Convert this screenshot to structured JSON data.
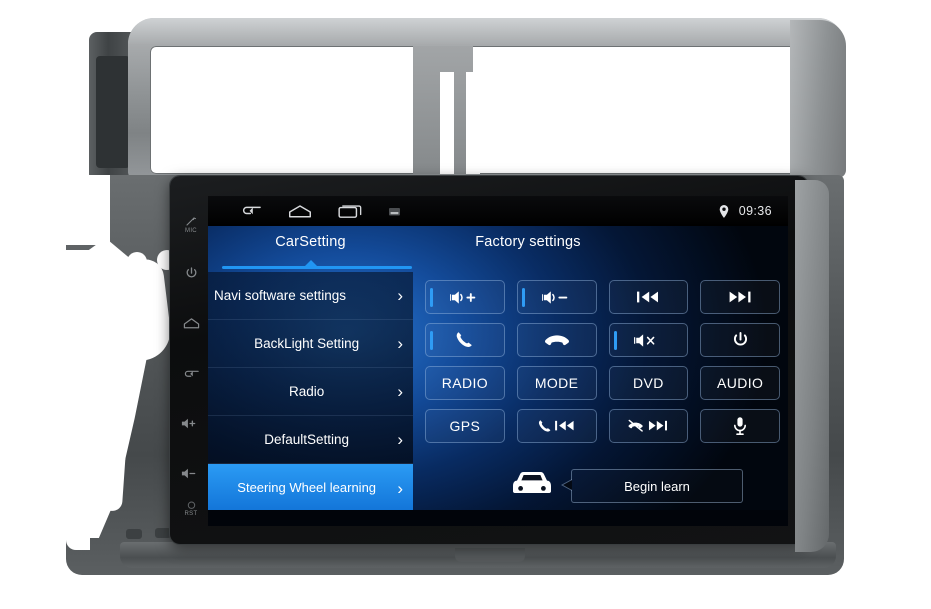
{
  "device": {
    "name": "car-head-unit-with-dash-fascia",
    "hard_keys": [
      {
        "name": "mic-key",
        "label": "MIC"
      },
      {
        "name": "power-key",
        "label": ""
      },
      {
        "name": "home-key",
        "label": ""
      },
      {
        "name": "back-key",
        "label": ""
      },
      {
        "name": "volume-up-key",
        "label": ""
      },
      {
        "name": "volume-down-key",
        "label": ""
      },
      {
        "name": "reset-key",
        "label": "RST"
      }
    ]
  },
  "statusbar": {
    "icons": [
      "back-icon",
      "home-icon",
      "recents-icon",
      "screenshot-icon"
    ],
    "location_icon": "location-pin-icon",
    "clock": "09:36"
  },
  "tabs": [
    {
      "label": "CarSetting",
      "active": true
    },
    {
      "label": "Factory settings",
      "active": false
    }
  ],
  "sidebar": {
    "items": [
      {
        "label": "Navi software settings",
        "chevron": "›",
        "active": false
      },
      {
        "label": "BackLight Setting",
        "chevron": "›",
        "active": false
      },
      {
        "label": "Radio",
        "chevron": "›",
        "active": false
      },
      {
        "label": "DefaultSetting",
        "chevron": "›",
        "active": false
      },
      {
        "label": "Steering Wheel learning",
        "chevron": "›",
        "active": true
      }
    ]
  },
  "steering_wheel_panel": {
    "buttons": [
      {
        "id": "vol-up",
        "text": "",
        "icon": "volume-up-icon",
        "indicator": true
      },
      {
        "id": "vol-down",
        "text": "",
        "icon": "volume-down-icon",
        "indicator": true
      },
      {
        "id": "prev-track",
        "text": "",
        "icon": "previous-track-icon",
        "indicator": false
      },
      {
        "id": "next-track",
        "text": "",
        "icon": "next-track-icon",
        "indicator": false
      },
      {
        "id": "call",
        "text": "",
        "icon": "phone-answer-icon",
        "indicator": true
      },
      {
        "id": "hangup",
        "text": "",
        "icon": "phone-hangup-icon",
        "indicator": false
      },
      {
        "id": "mute",
        "text": "",
        "icon": "volume-mute-icon",
        "indicator": true
      },
      {
        "id": "power",
        "text": "",
        "icon": "power-icon",
        "indicator": false
      },
      {
        "id": "radio",
        "text": "RADIO",
        "icon": "",
        "indicator": false
      },
      {
        "id": "mode",
        "text": "MODE",
        "icon": "",
        "indicator": false
      },
      {
        "id": "dvd",
        "text": "DVD",
        "icon": "",
        "indicator": false
      },
      {
        "id": "audio",
        "text": "AUDIO",
        "icon": "",
        "indicator": false
      },
      {
        "id": "gps",
        "text": "GPS",
        "icon": "",
        "indicator": false
      },
      {
        "id": "call-prev",
        "text": "",
        "icon": "phone-previous-icon",
        "indicator": false
      },
      {
        "id": "hangup-next",
        "text": "",
        "icon": "phone-hangup-next-icon",
        "indicator": false
      },
      {
        "id": "voice",
        "text": "",
        "icon": "microphone-icon",
        "indicator": false
      }
    ],
    "car_icon": "car-front-icon",
    "begin_learn_label": "Begin learn"
  },
  "colors": {
    "accent_blue": "#2196f3",
    "active_item_blue": "#1f8ef0",
    "screen_dark": "#01060e",
    "bezel_black": "#121314",
    "fascia_silver": "#8f9395"
  }
}
